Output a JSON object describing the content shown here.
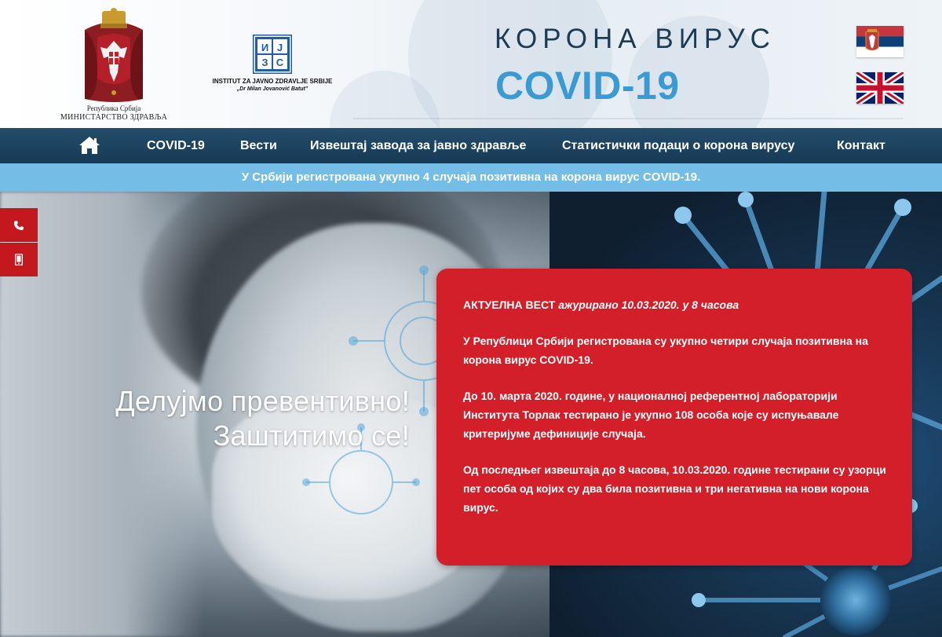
{
  "header": {
    "ministry": {
      "line1": "Република Србија",
      "line2": "МИНИСТАРСТВО ЗДРАВЉА"
    },
    "institute": {
      "logo_letters": [
        "И",
        "Ј",
        "З",
        "С"
      ],
      "line1": "INSTITUT ZA JAVNO ZDRAVLJE SRBIJE",
      "line2": "„Dr Milan Jovanović Batut”"
    },
    "title_top": "КОРОНА ВИРУС",
    "title_main": "COVID-19",
    "languages": [
      {
        "code": "sr",
        "icon": "serbian-flag-icon"
      },
      {
        "code": "en",
        "icon": "uk-flag-icon"
      }
    ]
  },
  "nav": {
    "home_icon": "home-icon",
    "items": [
      {
        "label": "COVID-19"
      },
      {
        "label": "Вести"
      },
      {
        "label": "Извештај завода за јавно здравље"
      },
      {
        "label": "Статистички подаци о корона вирусу"
      },
      {
        "label": "Контакт"
      }
    ]
  },
  "ticker": {
    "text": "У Србији регистрована укупно 4 случаја позитивна на корона вирус COVID-19."
  },
  "hero": {
    "heading_line1": "Делујмо превентивно!",
    "heading_line2": "Заштитимо се!"
  },
  "side_contact": {
    "items": [
      {
        "icon": "phone-icon"
      },
      {
        "icon": "mobile-phone-icon"
      }
    ]
  },
  "news": {
    "label": "АКТУЕЛНА ВЕСТ",
    "updated": "ажурирано 10.03.2020. у 8 часова",
    "paragraphs": [
      "У Републици Србији регистрована су укупно четири случаја позитивна на корона вирус COVID-19.",
      "До  10. марта 2020. године, у националној референтној лабораторији Института Торлак тестирано је  укупно 108 особа које су испуњавале критеријуме дефиниције случаја.",
      "Од последњег извештаја до 8 часова, 10.03.2020. године тестирани су узорци пет особа од којих су два била позитивна и три негативна на нови корона вирус."
    ]
  },
  "colors": {
    "nav_bg": "#173a55",
    "ticker_bg": "#74bde6",
    "news_bg": "#d21f2a",
    "title_dark": "#1d3b55",
    "title_blue": "#3c9ad3",
    "side_tab": "#c4181f"
  }
}
